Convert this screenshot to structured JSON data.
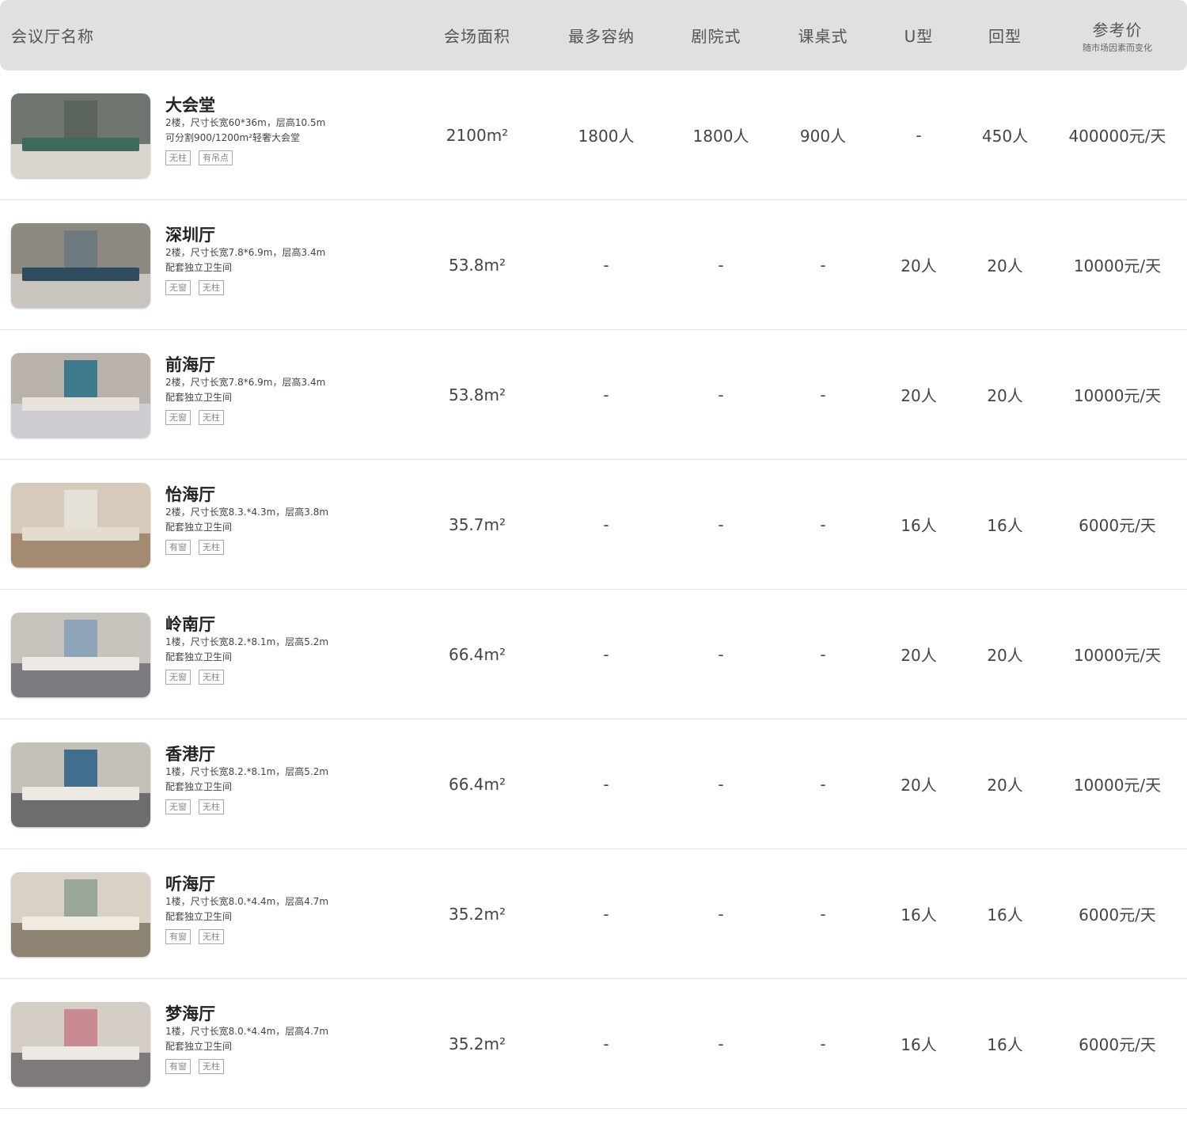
{
  "header": {
    "name": "会议厅名称",
    "area": "会场面积",
    "max": "最多容纳",
    "theater": "剧院式",
    "classroom": "课桌式",
    "u_shape": "U型",
    "hollow": "回型",
    "price": "参考价",
    "price_note": "随市场因素而变化"
  },
  "rows": [
    {
      "name": "大会堂",
      "line1": "2楼，尺寸长宽60*36m，层高10.5m",
      "line2": "可分割900/1200m²轻奢大会堂",
      "tags": [
        "无柱",
        "有吊点"
      ],
      "area": "2100m²",
      "max": "1800人",
      "theater": "1800人",
      "classroom": "900人",
      "u": "-",
      "hui": "450人",
      "price": "400000元/天",
      "thumb": {
        "wall": "#6f7670",
        "floor": "#d9d4cc",
        "art": "#5b635d",
        "chairs": "#3e6a5e"
      }
    },
    {
      "name": "深圳厅",
      "line1": "2楼，尺寸长宽7.8*6.9m，层高3.4m",
      "line2": "配套独立卫生间",
      "tags": [
        "无窗",
        "无柱"
      ],
      "area": "53.8m²",
      "max": "-",
      "theater": "-",
      "classroom": "-",
      "u": "20人",
      "hui": "20人",
      "price": "10000元/天",
      "thumb": {
        "wall": "#8e8a82",
        "floor": "#c9c4bd",
        "art": "#6f7a80",
        "chairs": "#2f4b5e"
      }
    },
    {
      "name": "前海厅",
      "line1": "2楼，尺寸长宽7.8*6.9m，层高3.4m",
      "line2": "配套独立卫生间",
      "tags": [
        "无窗",
        "无柱"
      ],
      "area": "53.8m²",
      "max": "-",
      "theater": "-",
      "classroom": "-",
      "u": "20人",
      "hui": "20人",
      "price": "10000元/天",
      "thumb": {
        "wall": "#b8b2aa",
        "floor": "#cfcbd2",
        "art": "#3f7a8c",
        "chairs": "#e8e3da"
      }
    },
    {
      "name": "怡海厅",
      "line1": "2楼，尺寸长宽8.3.*4.3m，层高3.8m",
      "line2": "配套独立卫生间",
      "tags": [
        "有窗",
        "无柱"
      ],
      "area": "35.7m²",
      "max": "-",
      "theater": "-",
      "classroom": "-",
      "u": "16人",
      "hui": "16人",
      "price": "6000元/天",
      "thumb": {
        "wall": "#d6cbbb",
        "floor": "#a38a70",
        "art": "#e6e1d8",
        "chairs": "#e3dccf"
      }
    },
    {
      "name": "岭南厅",
      "line1": "1楼，尺寸长宽8.2.*8.1m，层高5.2m",
      "line2": "配套独立卫生间",
      "tags": [
        "无窗",
        "无柱"
      ],
      "area": "66.4m²",
      "max": "-",
      "theater": "-",
      "classroom": "-",
      "u": "20人",
      "hui": "20人",
      "price": "10000元/天",
      "thumb": {
        "wall": "#c7c3bc",
        "floor": "#7d7b80",
        "art": "#8fa3b8",
        "chairs": "#ece8e2"
      }
    },
    {
      "name": "香港厅",
      "line1": "1楼，尺寸长宽8.2.*8.1m，层高5.2m",
      "line2": "配套独立卫生间",
      "tags": [
        "无窗",
        "无柱"
      ],
      "area": "66.4m²",
      "max": "-",
      "theater": "-",
      "classroom": "-",
      "u": "20人",
      "hui": "20人",
      "price": "10000元/天",
      "thumb": {
        "wall": "#c5c0b8",
        "floor": "#6f6c70",
        "art": "#3f6f8c",
        "chairs": "#ece8e2"
      }
    },
    {
      "name": "听海厅",
      "line1": "1楼，尺寸长宽8.0.*4.4m，层高4.7m",
      "line2": "配套独立卫生间",
      "tags": [
        "有窗",
        "无柱"
      ],
      "area": "35.2m²",
      "max": "-",
      "theater": "-",
      "classroom": "-",
      "u": "16人",
      "hui": "16人",
      "price": "6000元/天",
      "thumb": {
        "wall": "#d8d2c6",
        "floor": "#8c8372",
        "art": "#9aa69a",
        "chairs": "#f0ebe1"
      }
    },
    {
      "name": "梦海厅",
      "line1": "1楼，尺寸长宽8.0.*4.4m，层高4.7m",
      "line2": "配套独立卫生间",
      "tags": [
        "有窗",
        "无柱"
      ],
      "area": "35.2m²",
      "max": "-",
      "theater": "-",
      "classroom": "-",
      "u": "16人",
      "hui": "16人",
      "price": "6000元/天",
      "thumb": {
        "wall": "#d4cec6",
        "floor": "#7e7a7a",
        "art": "#c98a93",
        "chairs": "#ece8e2"
      }
    }
  ]
}
